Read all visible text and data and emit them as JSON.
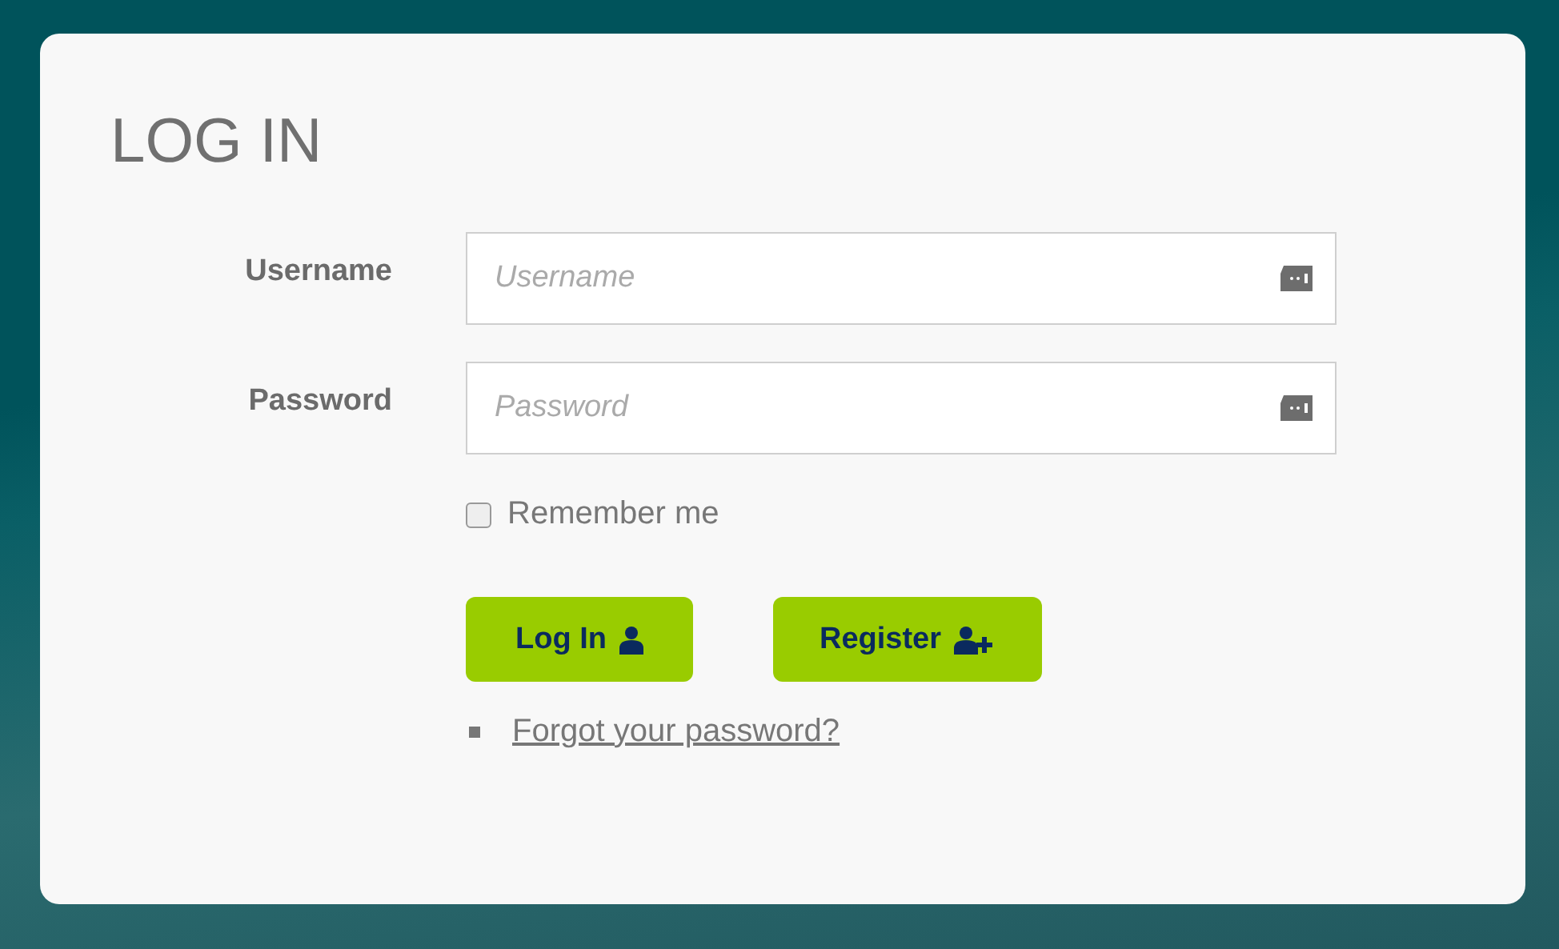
{
  "title": "LOG IN",
  "fields": [
    {
      "label": "Username",
      "placeholder": "Username"
    },
    {
      "label": "Password",
      "placeholder": "Password"
    }
  ],
  "remember": {
    "label": "Remember me",
    "checked": false
  },
  "buttons": [
    {
      "label": "Log In",
      "kind": "login"
    },
    {
      "label": "Register",
      "kind": "register"
    }
  ],
  "links": [
    "Forgot your password?"
  ]
}
